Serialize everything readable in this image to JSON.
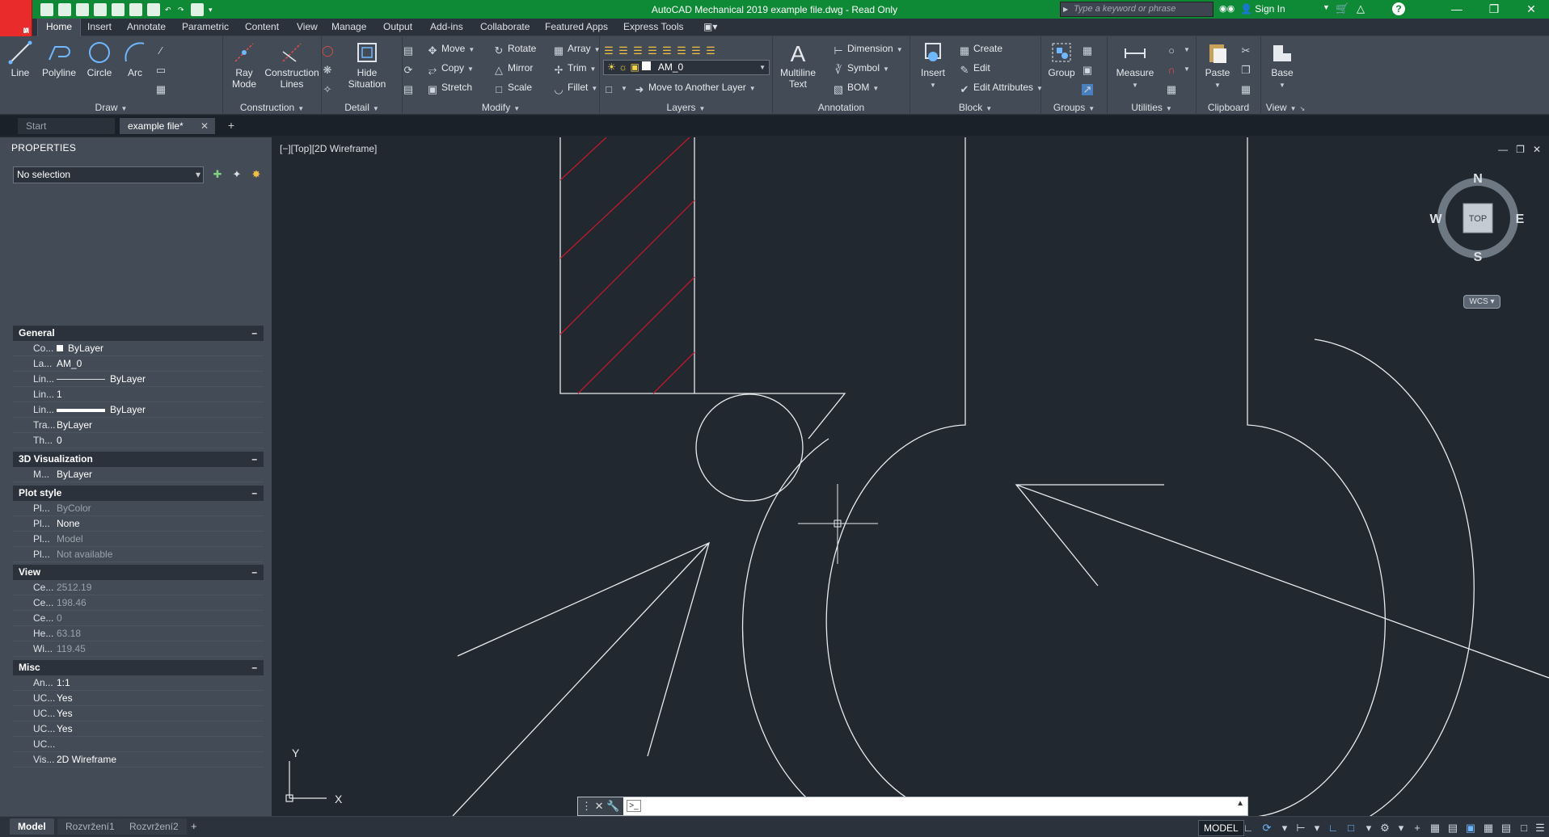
{
  "titlebar": {
    "app_logo": "A",
    "app_logo_sub": "M",
    "title": "AutoCAD Mechanical 2019    example file.dwg - Read Only",
    "search_placeholder": "Type a keyword or phrase",
    "sign_in": "Sign In",
    "help": "?"
  },
  "ribbon_tabs": [
    "Home",
    "Insert",
    "Annotate",
    "Parametric",
    "Content",
    "View",
    "Manage",
    "Output",
    "Add-ins",
    "Collaborate",
    "Featured Apps",
    "Express Tools"
  ],
  "ribbon": {
    "draw": {
      "title": "Draw",
      "line": "Line",
      "polyline": "Polyline",
      "circle": "Circle",
      "arc": "Arc"
    },
    "construction": {
      "title": "Construction",
      "ray_mode": [
        "Ray",
        "Mode"
      ],
      "construction_lines": [
        "Construction",
        "Lines"
      ]
    },
    "detail": {
      "title": "Detail",
      "hide_situation": [
        "Hide",
        "Situation"
      ]
    },
    "modify": {
      "title": "Modify",
      "move": "Move",
      "rotate": "Rotate",
      "array": "Array",
      "copy": "Copy",
      "mirror": "Mirror",
      "trim": "Trim",
      "stretch": "Stretch",
      "scale": "Scale",
      "fillet": "Fillet"
    },
    "layers": {
      "title": "Layers",
      "current_layer": "AM_0",
      "move_layer": "Move to Another Layer"
    },
    "annotation": {
      "title": "Annotation",
      "multiline_text": [
        "Multiline",
        "Text"
      ],
      "dimension": "Dimension",
      "symbol": "Symbol",
      "bom": "BOM"
    },
    "block": {
      "title": "Block",
      "insert": "Insert",
      "create": "Create",
      "edit": "Edit",
      "edit_attributes": "Edit Attributes"
    },
    "groups": {
      "title": "Groups",
      "group": "Group"
    },
    "utilities": {
      "title": "Utilities",
      "measure": "Measure"
    },
    "clipboard": {
      "title": "Clipboard",
      "paste": "Paste"
    },
    "view": {
      "title": "View",
      "base": "Base"
    }
  },
  "doc_tabs": [
    "Start",
    "example file*"
  ],
  "properties": {
    "title": "PROPERTIES",
    "selection": "No selection",
    "sections": [
      {
        "name": "General",
        "rows": [
          {
            "n": "Co...",
            "v": "ByLayer"
          },
          {
            "n": "La...",
            "v": "AM_0"
          },
          {
            "n": "Lin...",
            "v": "ByLayer"
          },
          {
            "n": "Lin...",
            "v": "1"
          },
          {
            "n": "Lin...",
            "v": "ByLayer"
          },
          {
            "n": "Tra...",
            "v": "ByLayer"
          },
          {
            "n": "Th...",
            "v": "0"
          }
        ]
      },
      {
        "name": "3D Visualization",
        "rows": [
          {
            "n": "M...",
            "v": "ByLayer"
          }
        ]
      },
      {
        "name": "Plot style",
        "rows": [
          {
            "n": "Pl...",
            "v": "ByColor"
          },
          {
            "n": "Pl...",
            "v": "None"
          },
          {
            "n": "Pl...",
            "v": "Model"
          },
          {
            "n": "Pl...",
            "v": "Not available"
          }
        ]
      },
      {
        "name": "View",
        "rows": [
          {
            "n": "Ce...",
            "v": "2512.19"
          },
          {
            "n": "Ce...",
            "v": "198.46"
          },
          {
            "n": "Ce...",
            "v": "0"
          },
          {
            "n": "He...",
            "v": "63.18"
          },
          {
            "n": "Wi...",
            "v": "119.45"
          }
        ]
      },
      {
        "name": "Misc",
        "rows": [
          {
            "n": "An...",
            "v": "1:1"
          },
          {
            "n": "UC...",
            "v": "Yes"
          },
          {
            "n": "UC...",
            "v": "Yes"
          },
          {
            "n": "UC...",
            "v": "Yes"
          },
          {
            "n": "UC...",
            "v": ""
          },
          {
            "n": "Vis...",
            "v": "2D Wireframe"
          }
        ]
      }
    ]
  },
  "viewport": {
    "label": "[−][Top][2D Wireframe]",
    "compass": {
      "n": "N",
      "s": "S",
      "e": "E",
      "w": "W",
      "cube": "TOP"
    },
    "wcs": "WCS",
    "ucs_x": "X",
    "ucs_y": "Y"
  },
  "command": {
    "placeholder": ""
  },
  "status": {
    "layout_tabs": [
      "Model",
      "Rozvržení1",
      "Rozvržení2"
    ],
    "model_button": "MODEL"
  },
  "colors": {
    "titlebar": "#0e8a36",
    "canvas": "#212830",
    "hatch": "#c0182a",
    "logo": "#ea2b2b"
  }
}
